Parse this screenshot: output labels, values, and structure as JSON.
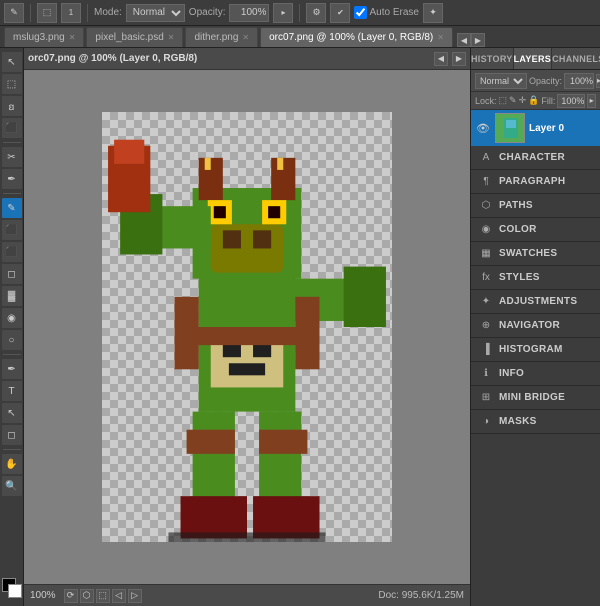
{
  "toolbar": {
    "mode_label": "Mode:",
    "mode_value": "Normal",
    "opacity_label": "Opacity:",
    "opacity_value": "100%",
    "auto_erase_label": "Auto Erase"
  },
  "tabs": [
    {
      "label": "mslug3.png",
      "active": false
    },
    {
      "label": "pixel_basic.psd",
      "active": false
    },
    {
      "label": "dither.png",
      "active": false
    },
    {
      "label": "orc07.png @ 100% (Layer 0, RGB/8)",
      "active": true
    }
  ],
  "canvas": {
    "title": "orc07.png @ 100% (Layer 0, RGB/8)",
    "zoom": "100%",
    "doc_info": "Doc: 995.6K/1.25M"
  },
  "right_panel": {
    "top_tabs": [
      {
        "label": "HISTORY",
        "active": false
      },
      {
        "label": "LAYERS",
        "active": true
      },
      {
        "label": "CHANNELS",
        "active": false
      }
    ],
    "layers_blend": "Normal",
    "opacity_value": "100%",
    "fill_value": "100%",
    "layer_name": "Layer 0",
    "panels": [
      {
        "id": "character",
        "label": "CHARACTER",
        "icon": "A"
      },
      {
        "id": "paragraph",
        "label": "PARAGRAPH",
        "icon": "¶"
      },
      {
        "id": "paths",
        "label": "PATHS",
        "icon": "⬡"
      },
      {
        "id": "color",
        "label": "COLOR",
        "icon": "◉"
      },
      {
        "id": "swatches",
        "label": "SWATCHES",
        "icon": "▦"
      },
      {
        "id": "styles",
        "label": "STYLES",
        "icon": "fx"
      },
      {
        "id": "adjustments",
        "label": "ADJUSTMENTS",
        "icon": "✦"
      },
      {
        "id": "navigator",
        "label": "NAVIGATOR",
        "icon": "⊕"
      },
      {
        "id": "histogram",
        "label": "HISTOGRAM",
        "icon": "▐"
      },
      {
        "id": "info",
        "label": "INFO",
        "icon": "ℹ"
      },
      {
        "id": "mini-bridge",
        "label": "MINI BRIDGE",
        "icon": "⊞"
      },
      {
        "id": "masks",
        "label": "MASKS",
        "icon": "◑"
      }
    ]
  },
  "left_tools": [
    {
      "icon": "↖",
      "label": "Move"
    },
    {
      "icon": "⬚",
      "label": "Marquee"
    },
    {
      "icon": "✂",
      "label": "Lasso"
    },
    {
      "icon": "⬛",
      "label": "Quick Select"
    },
    {
      "icon": "✂",
      "label": "Crop"
    },
    {
      "icon": "✒",
      "label": "Eyedropper"
    },
    {
      "icon": "✎",
      "label": "Brush",
      "active": true
    },
    {
      "icon": "⬛",
      "label": "Clone Stamp"
    },
    {
      "icon": "⬛",
      "label": "History Brush"
    },
    {
      "icon": "◻",
      "label": "Eraser"
    },
    {
      "icon": "▓",
      "label": "Gradient"
    },
    {
      "icon": "⬛",
      "label": "Blur"
    },
    {
      "icon": "⬛",
      "label": "Dodge"
    },
    {
      "icon": "✒",
      "label": "Pen"
    },
    {
      "icon": "T",
      "label": "Type"
    },
    {
      "icon": "⬡",
      "label": "Path Select"
    },
    {
      "icon": "◻",
      "label": "Shape"
    },
    {
      "icon": "🔍",
      "label": "Zoom"
    },
    {
      "icon": "✋",
      "label": "Hand"
    }
  ]
}
